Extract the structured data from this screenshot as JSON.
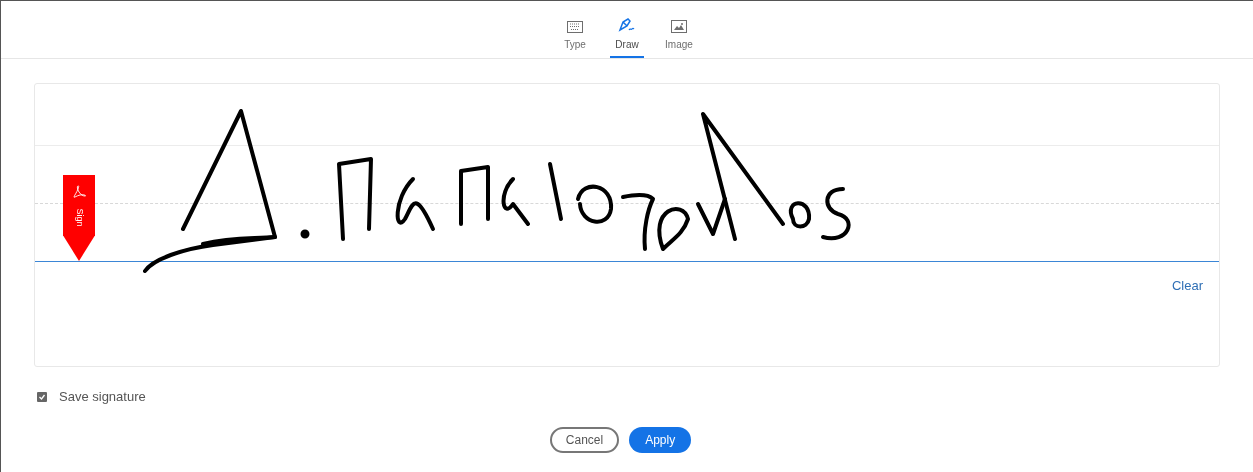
{
  "tabs": [
    {
      "kind": "keyboard",
      "label": "Type",
      "selected": false
    },
    {
      "kind": "pen",
      "label": "Draw",
      "selected": true
    },
    {
      "kind": "image",
      "label": "Image",
      "selected": false
    }
  ],
  "sign_marker": {
    "label": "Sign"
  },
  "clear_link": "Clear",
  "save_signature": {
    "label": "Save signature",
    "checked": true
  },
  "buttons": {
    "cancel": "Cancel",
    "apply": "Apply"
  }
}
